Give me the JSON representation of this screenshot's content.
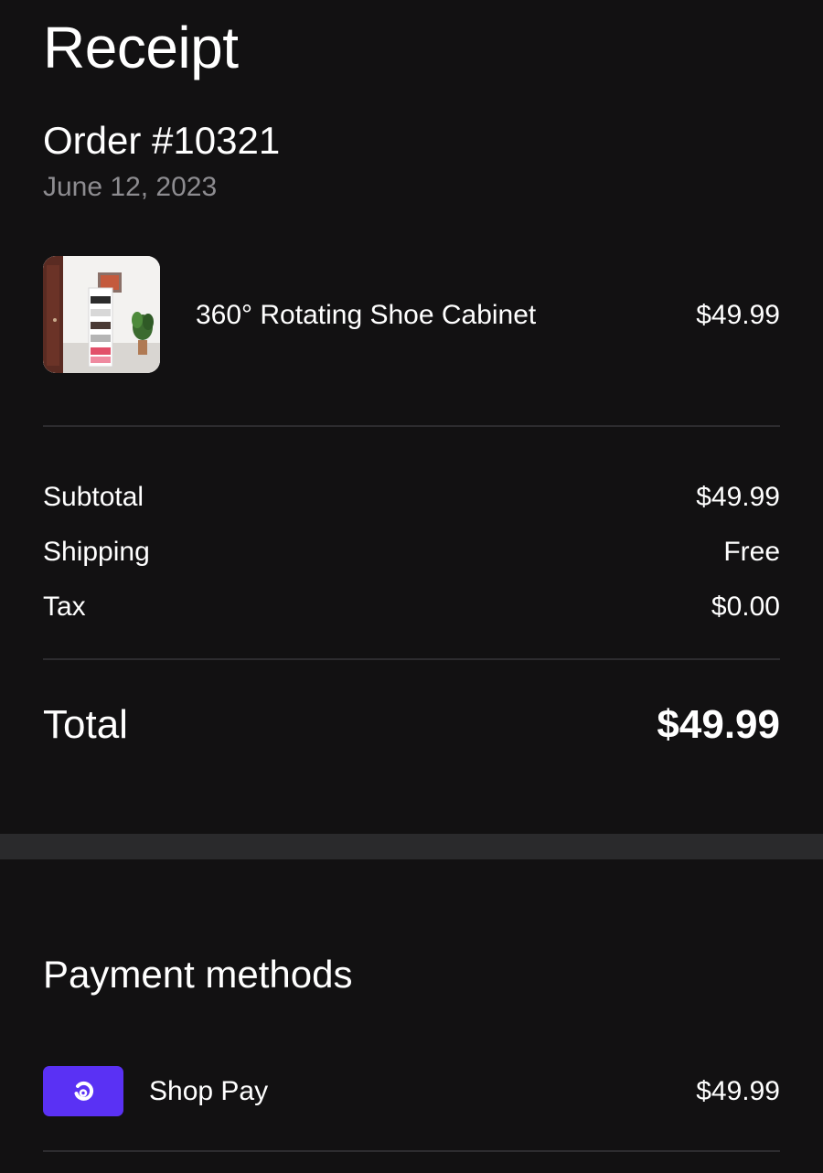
{
  "header": {
    "title": "Receipt"
  },
  "order": {
    "number": "Order #10321",
    "date": "June 12, 2023"
  },
  "items": [
    {
      "name": "360° Rotating Shoe Cabinet",
      "price": "$49.99",
      "thumbnail_icon": "shoe-cabinet-photo"
    }
  ],
  "summary": {
    "subtotal_label": "Subtotal",
    "subtotal_value": "$49.99",
    "shipping_label": "Shipping",
    "shipping_value": "Free",
    "tax_label": "Tax",
    "tax_value": "$0.00",
    "total_label": "Total",
    "total_value": "$49.99"
  },
  "payment": {
    "heading": "Payment methods",
    "methods": [
      {
        "name": "Shop Pay",
        "amount": "$49.99",
        "icon": "shop-pay-icon",
        "brand_color": "#5a31f4"
      }
    ]
  },
  "colors": {
    "background": "#121112",
    "text_primary": "#ffffff",
    "text_secondary": "#8d8c90",
    "divider": "#2d2c2f",
    "section_band": "#2a2a2c"
  }
}
